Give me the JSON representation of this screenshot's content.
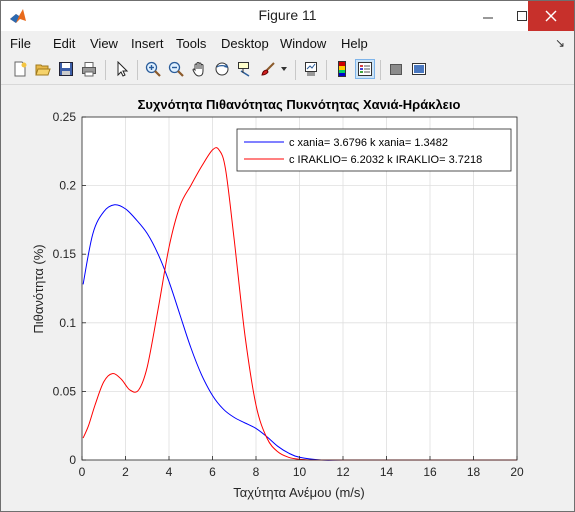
{
  "window": {
    "title": "Figure 11"
  },
  "menu": [
    "File",
    "Edit",
    "View",
    "Insert",
    "Tools",
    "Desktop",
    "Window",
    "Help"
  ],
  "toolbar": [
    {
      "icon": "new-figure-icon"
    },
    {
      "icon": "open-file-icon"
    },
    {
      "icon": "save-icon"
    },
    {
      "icon": "print-icon"
    },
    {
      "icon": "edit-plot-arrow-icon"
    },
    {
      "icon": "zoom-in-icon"
    },
    {
      "icon": "zoom-out-icon"
    },
    {
      "icon": "pan-hand-icon"
    },
    {
      "icon": "rotate-3d-icon"
    },
    {
      "icon": "data-cursor-icon"
    },
    {
      "icon": "brush-icon"
    },
    {
      "icon": "link-plot-icon"
    },
    {
      "icon": "colorbar-icon"
    },
    {
      "icon": "legend-icon"
    },
    {
      "icon": "hide-plot-tools-icon"
    },
    {
      "icon": "show-plot-tools-icon"
    }
  ],
  "chart_data": {
    "type": "line",
    "title": "Συχνότητα Πιθανότητας Πυκνότητας Χανιά-Ηράκλειο",
    "xlabel": "Ταχύτητα Ανέμου (m/s)",
    "ylabel": "Πιθανότητα (%)",
    "xlim": [
      0,
      20
    ],
    "ylim": [
      0,
      0.25
    ],
    "xticks": [
      "0",
      "2",
      "4",
      "6",
      "8",
      "10",
      "12",
      "14",
      "16",
      "18",
      "20"
    ],
    "yticks": [
      "0",
      "0.05",
      "0.1",
      "0.15",
      "0.2",
      "0.25"
    ],
    "grid": true,
    "legend_position": "top-right",
    "series": [
      {
        "name": "c xania= 3.6796 k xania= 1.3482",
        "color": "#0000ff",
        "x": [
          0.05,
          0.5,
          1.0,
          1.5,
          2.0,
          2.5,
          3.0,
          3.5,
          4.0,
          4.5,
          5.0,
          5.5,
          6.0,
          6.5,
          7.0,
          7.5,
          8.0,
          8.5,
          9.0,
          9.5,
          10.0,
          11.0,
          12.0,
          14.0,
          16.0,
          18.0,
          20.0
        ],
        "values": [
          0.128,
          0.165,
          0.181,
          0.186,
          0.183,
          0.175,
          0.165,
          0.15,
          0.13,
          0.106,
          0.082,
          0.062,
          0.047,
          0.037,
          0.031,
          0.027,
          0.023,
          0.017,
          0.01,
          0.005,
          0.002,
          0.0,
          0.0,
          0.0,
          0.0,
          0.0,
          0.0
        ]
      },
      {
        "name": "c IRAKLIO= 6.2032 k IRAKLIO= 3.7218",
        "color": "#ff0000",
        "x": [
          0.05,
          0.3,
          0.6,
          1.0,
          1.4,
          1.8,
          2.2,
          2.6,
          3.0,
          3.5,
          4.0,
          4.5,
          5.0,
          5.5,
          6.0,
          6.3,
          6.6,
          7.0,
          7.5,
          8.0,
          8.5,
          9.0,
          9.5,
          10.0,
          10.5,
          11.0,
          12.0,
          14.0,
          16.0,
          18.0,
          20.0
        ],
        "values": [
          0.016,
          0.025,
          0.04,
          0.057,
          0.063,
          0.059,
          0.051,
          0.051,
          0.068,
          0.11,
          0.155,
          0.185,
          0.2,
          0.214,
          0.226,
          0.226,
          0.212,
          0.16,
          0.09,
          0.04,
          0.016,
          0.006,
          0.002,
          0.0005,
          0.0,
          0.0,
          0.0,
          0.0,
          0.0,
          0.0,
          0.0
        ]
      }
    ]
  }
}
